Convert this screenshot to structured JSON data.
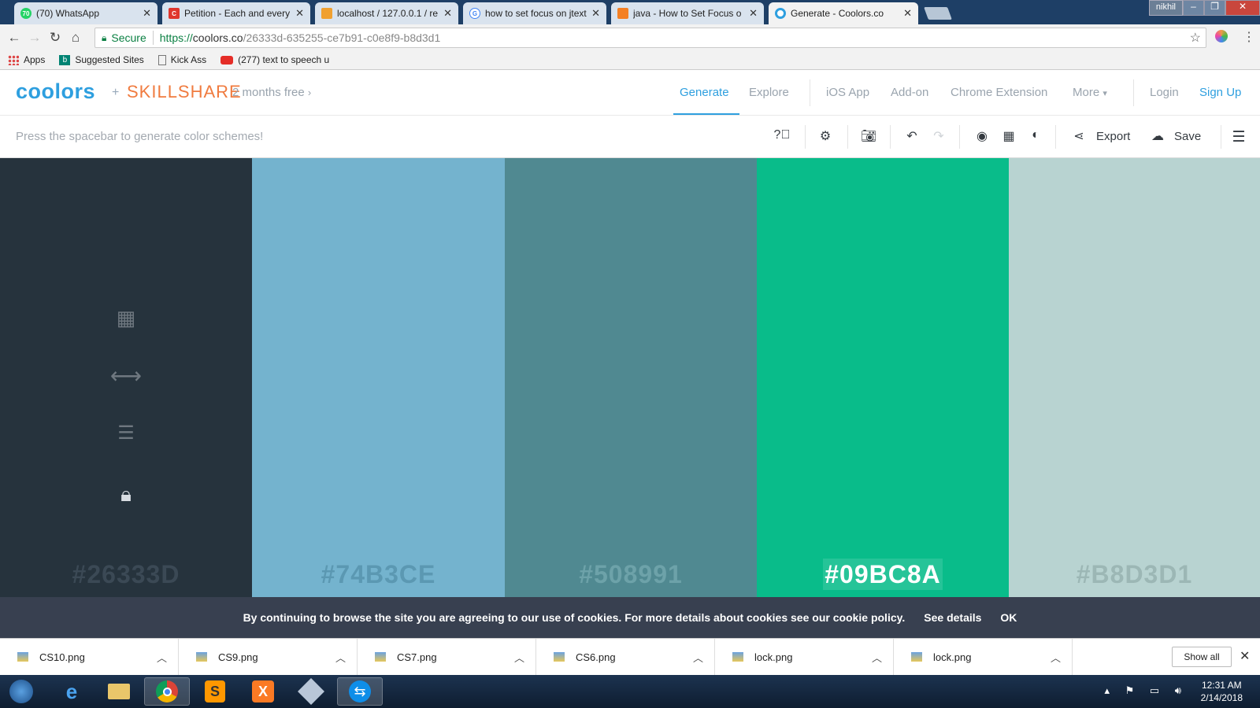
{
  "browser": {
    "tabs": [
      {
        "title": "(70) WhatsApp",
        "icon": "whatsapp-icon",
        "color": "#25d366"
      },
      {
        "title": "Petition - Each and every",
        "icon": "change-org-icon",
        "color": "#e0362c"
      },
      {
        "title": "localhost / 127.0.0.1 / re:",
        "icon": "phpmyadmin-icon",
        "color": "#f0a030"
      },
      {
        "title": "how to set focus on jtext",
        "icon": "google-icon",
        "color": "#4285f4"
      },
      {
        "title": "java - How to Set Focus o",
        "icon": "stackoverflow-icon",
        "color": "#f48024"
      },
      {
        "title": "Generate - Coolors.co",
        "icon": "coolors-icon",
        "color": "#2e9fdf"
      }
    ],
    "user": "nikhil",
    "secure_label": "Secure",
    "url_prefix": "https://",
    "url_host": "coolors.co",
    "url_path": "/26333d-635255-ce7b91-c0e8f9-b8d3d1",
    "bookmarks": [
      "Apps",
      "Suggested Sites",
      "Kick Ass",
      "(277) text to speech u"
    ]
  },
  "header": {
    "logo": "coolors",
    "plus": "+",
    "partner": "SKILLSHARE",
    "promo": "2 months free",
    "nav": [
      "Generate",
      "Explore",
      "iOS App",
      "Add-on",
      "Chrome Extension",
      "More",
      "Login",
      "Sign Up"
    ]
  },
  "toolbar": {
    "hint": "Press the spacebar to generate color schemes!",
    "export_label": "Export",
    "save_label": "Save"
  },
  "palette": {
    "colors": [
      {
        "hex": "#26333D",
        "bg": "#26333d",
        "text": "#3b4955"
      },
      {
        "hex": "#74B3CE",
        "bg": "#74b3ce",
        "text": "#5b98b2"
      },
      {
        "hex": "#508991",
        "bg": "#508991",
        "text": "#6da2a9"
      },
      {
        "hex": "#09BC8A",
        "bg": "#09bc8a",
        "text": "#ffffff"
      },
      {
        "hex": "#B8D3D1",
        "bg": "#b8d3d1",
        "text": "#9cb7b5"
      }
    ]
  },
  "cookie": {
    "message": "By continuing to browse the site you are agreeing to our use of cookies. For more details about cookies see our cookie policy.",
    "details": "See details",
    "ok": "OK"
  },
  "downloads": {
    "files": [
      "CS10.png",
      "CS9.png",
      "CS7.png",
      "CS6.png",
      "lock.png",
      "lock.png"
    ],
    "show_all": "Show all"
  },
  "taskbar": {
    "time": "12:31 AM",
    "date": "2/14/2018"
  }
}
